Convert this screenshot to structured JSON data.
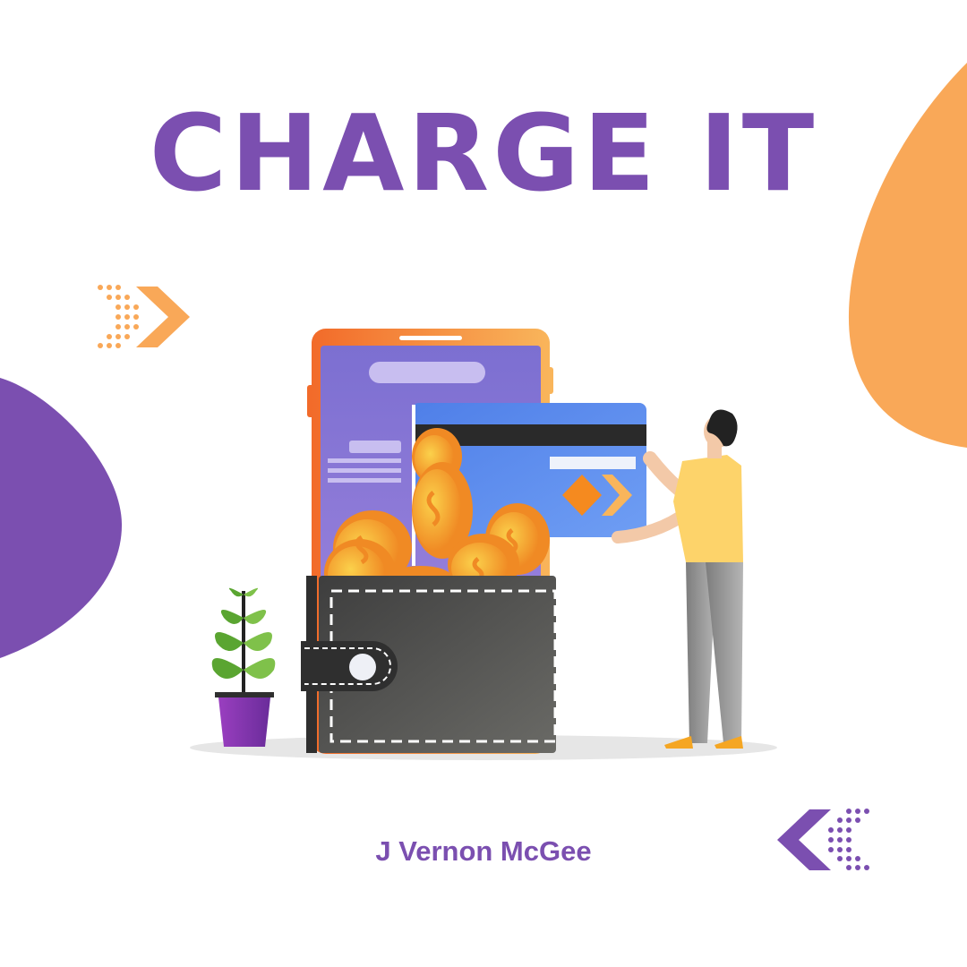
{
  "title": "CHARGE IT",
  "author": "J Vernon McGee",
  "colors": {
    "purple": "#7b4fb0",
    "orange": "#f9a858",
    "coin": "#f5a623",
    "card": "#5b8def",
    "wallet": "#4a4a4a",
    "shirt": "#fdd36a",
    "pants": "#9a9a9a"
  },
  "icons": [
    "arrow-right-dots-icon",
    "arrow-left-dots-icon",
    "phone-illustration",
    "credit-card-illustration",
    "wallet-illustration",
    "coins-illustration",
    "plant-illustration",
    "person-illustration"
  ]
}
